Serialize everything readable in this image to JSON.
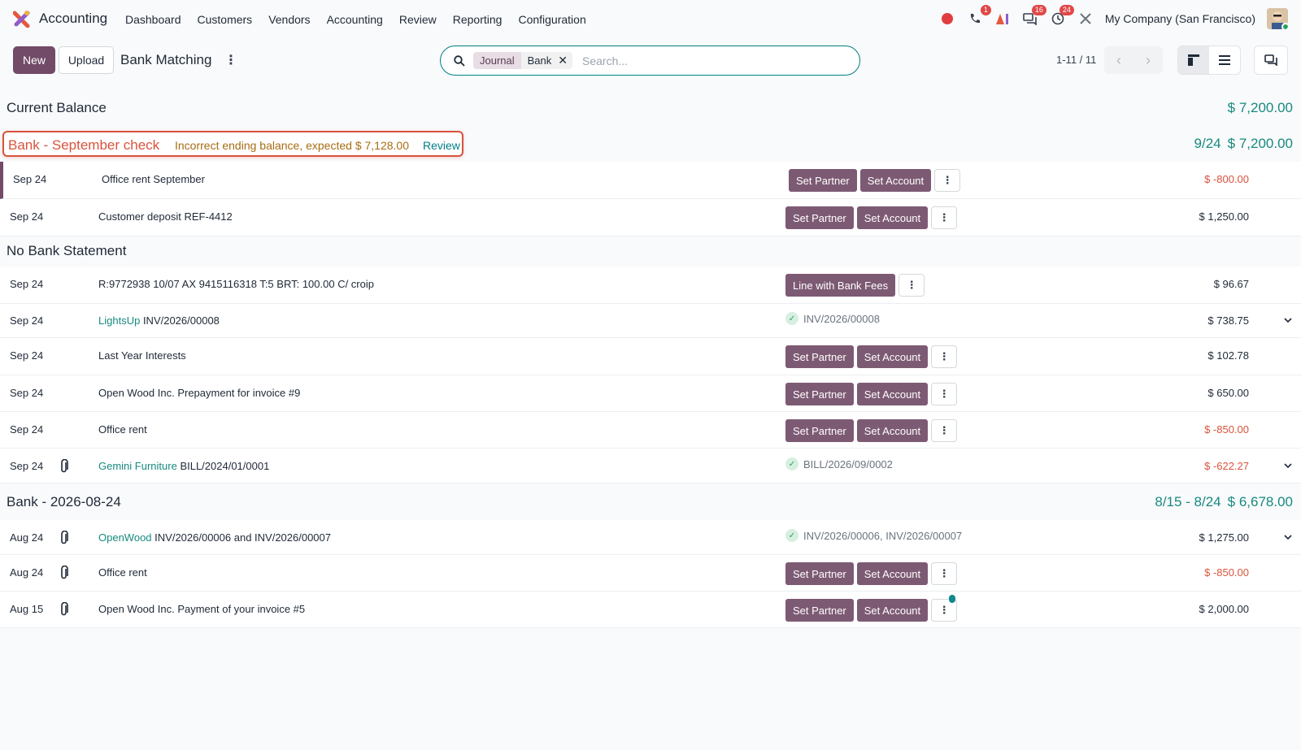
{
  "app": {
    "name": "Accounting"
  },
  "menu": [
    "Dashboard",
    "Customers",
    "Vendors",
    "Accounting",
    "Review",
    "Reporting",
    "Configuration"
  ],
  "systray": {
    "phone_badge": "1",
    "messages_badge": "16",
    "activity_badge": "24",
    "company": "My Company (San Francisco)"
  },
  "control": {
    "new_label": "New",
    "upload_label": "Upload",
    "title": "Bank Matching",
    "search": {
      "facet_label": "Journal",
      "facet_value": "Bank",
      "placeholder": "Search..."
    },
    "pager": "1-11 / 11"
  },
  "current_balance": {
    "label": "Current Balance",
    "amount": "$ 7,200.00"
  },
  "statements": [
    {
      "title": "Bank - September check",
      "warning": "Incorrect ending balance, expected $ 7,128.00",
      "review_label": "Review",
      "dates": "9/24",
      "amount": "$ 7,200.00",
      "lines": [
        {
          "date": "Sep 24",
          "label": "Office rent September",
          "amount": "$ -800.00"
        },
        {
          "date": "Sep 24",
          "label": "Customer deposit REF-4412",
          "amount": "$ 1,250.00"
        }
      ]
    },
    {
      "title": "No Bank Statement",
      "lines": [
        {
          "date": "Sep 24",
          "label": "R:9772938 10/07 AX 9415116318 T:5 BRT: 100.00 C/ croip",
          "action": "Line with Bank Fees",
          "amount": "$ 96.67"
        },
        {
          "date": "Sep 24",
          "partner": "LightsUp",
          "label": "INV/2026/00008",
          "matched": "INV/2026/00008",
          "amount": "$ 738.75"
        },
        {
          "date": "Sep 24",
          "label": "Last Year Interests",
          "amount": "$ 102.78"
        },
        {
          "date": "Sep 24",
          "label": "Open Wood Inc. Prepayment for invoice #9",
          "amount": "$ 650.00"
        },
        {
          "date": "Sep 24",
          "label": "Office rent",
          "amount": "$ -850.00"
        },
        {
          "date": "Sep 24",
          "partner": "Gemini Furniture",
          "label": "BILL/2024/01/0001",
          "matched": "BILL/2026/09/0002",
          "amount": "$ -622.27"
        }
      ]
    },
    {
      "title": "Bank - 2026-08-24",
      "dates": "8/15 - 8/24",
      "amount": "$ 6,678.00",
      "lines": [
        {
          "date": "Aug 24",
          "partner": "OpenWood",
          "label": "INV/2026/00006 and INV/2026/00007",
          "matched": "INV/2026/00006, INV/2026/00007",
          "amount": "$ 1,275.00"
        },
        {
          "date": "Aug 24",
          "label": "Office rent",
          "amount": "$ -850.00"
        },
        {
          "date": "Aug 15",
          "label": "Open Wood Inc. Payment of your invoice #5",
          "amount": "$ 2,000.00"
        }
      ]
    }
  ],
  "buttons": {
    "set_partner": "Set Partner",
    "set_account": "Set Account"
  },
  "colors": {
    "brand": "#714b67",
    "teal": "#178a7f",
    "negative": "#d9533d",
    "warning": "#a86c13"
  }
}
